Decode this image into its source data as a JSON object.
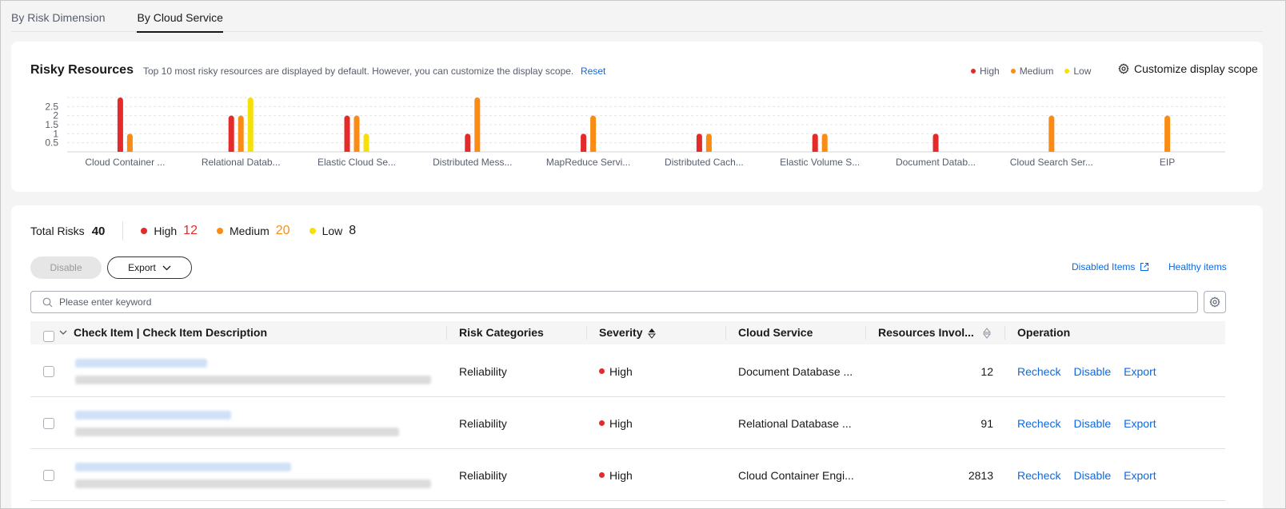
{
  "tabs": [
    {
      "label": "By Risk Dimension",
      "active": false
    },
    {
      "label": "By Cloud Service",
      "active": true
    }
  ],
  "risky_resources": {
    "title": "Risky Resources",
    "description": "Top 10 most risky resources are displayed by default. However, you can customize the display scope.",
    "reset_label": "Reset",
    "legend": [
      {
        "label": "High",
        "color": "#e32b2b"
      },
      {
        "label": "Medium",
        "color": "#fa8c16"
      },
      {
        "label": "Low",
        "color": "#f5e10a"
      }
    ],
    "customize_label": "Customize display scope"
  },
  "chart_data": {
    "type": "bar",
    "categories": [
      "Cloud Container ...",
      "Relational Datab...",
      "Elastic Cloud Se...",
      "Distributed Mess...",
      "MapReduce Servi...",
      "Distributed Cach...",
      "Elastic Volume S...",
      "Document Datab...",
      "Cloud Search Ser...",
      "EIP"
    ],
    "series": [
      {
        "name": "High",
        "color": "#e32b2b",
        "values": [
          3,
          2,
          2,
          1,
          1,
          1,
          1,
          1,
          0,
          0
        ]
      },
      {
        "name": "Medium",
        "color": "#fa8c16",
        "values": [
          1,
          2,
          2,
          3,
          2,
          1,
          1,
          0,
          2,
          2
        ]
      },
      {
        "name": "Low",
        "color": "#f5e10a",
        "values": [
          0,
          3,
          1,
          0,
          0,
          0,
          0,
          0,
          0,
          0
        ]
      }
    ],
    "yticks": [
      "0.5",
      "1",
      "1.5",
      "2",
      "2.5"
    ],
    "ylim": [
      0,
      3
    ],
    "grid": true
  },
  "summary": {
    "total_label": "Total Risks",
    "total_value": "40",
    "high_label": "High",
    "high_value": "12",
    "high_color": "#e32b2b",
    "medium_label": "Medium",
    "medium_value": "20",
    "medium_color": "#fa8c16",
    "low_label": "Low",
    "low_value": "8",
    "low_color": "#f5e10a"
  },
  "toolbar": {
    "disable_label": "Disable",
    "export_label": "Export",
    "disabled_items_label": "Disabled Items",
    "healthy_items_label": "Healthy items"
  },
  "search": {
    "placeholder": "Please enter keyword",
    "value": ""
  },
  "table": {
    "columns": {
      "check_item": "Check Item | Check Item Description",
      "risk_categories": "Risk Categories",
      "severity": "Severity",
      "cloud_service": "Cloud Service",
      "resources": "Resources Invol...",
      "operation": "Operation"
    },
    "rows": [
      {
        "risk_category": "Reliability",
        "severity": "High",
        "cloud_service": "Document Database ...",
        "resources": "12"
      },
      {
        "risk_category": "Reliability",
        "severity": "High",
        "cloud_service": "Relational Database ...",
        "resources": "91"
      },
      {
        "risk_category": "Reliability",
        "severity": "High",
        "cloud_service": "Cloud Container Engi...",
        "resources": "2813"
      }
    ],
    "operations": {
      "recheck": "Recheck",
      "disable": "Disable",
      "export": "Export"
    }
  }
}
